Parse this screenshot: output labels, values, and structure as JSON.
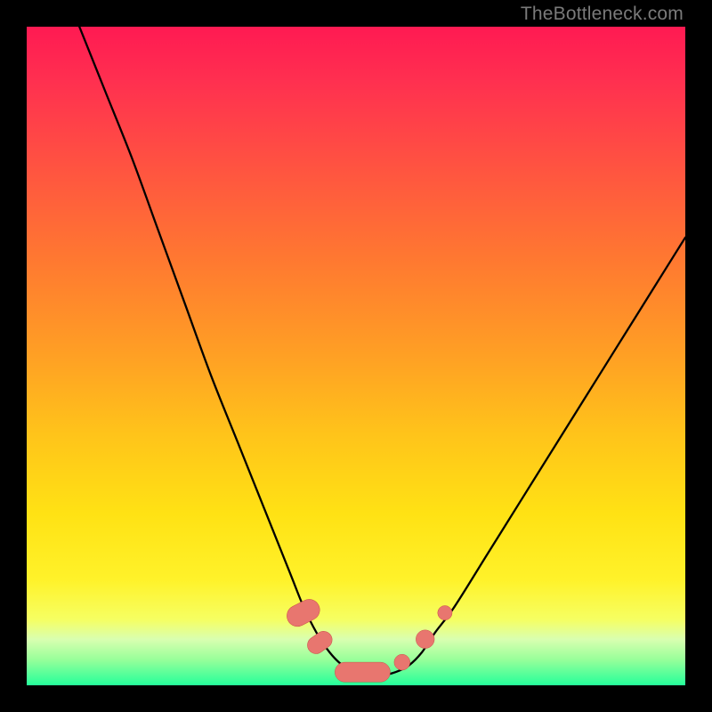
{
  "watermark": "TheBottleneck.com",
  "colors": {
    "frame": "#000000",
    "gradient_top": "#ff1a52",
    "gradient_bottom": "#25ff9a",
    "curve_stroke": "#000000",
    "marker_fill": "#e8766f",
    "marker_stroke": "#c94f46"
  },
  "chart_data": {
    "type": "line",
    "title": "",
    "xlabel": "",
    "ylabel": "",
    "xlim": [
      0,
      100
    ],
    "ylim": [
      0,
      100
    ],
    "grid": false,
    "legend": false,
    "note": "Both axes are unlabeled in the source; values below are estimated percentages of the plot extent (0 = left/bottom, 100 = right/top).",
    "series": [
      {
        "name": "curve",
        "x": [
          8,
          12,
          16,
          20,
          24,
          28,
          32,
          36,
          40,
          42,
          44,
          46,
          48,
          50,
          52,
          54,
          56,
          58,
          60,
          62,
          65,
          70,
          75,
          80,
          85,
          90,
          95,
          100
        ],
        "y": [
          100,
          90,
          80,
          69,
          58,
          47,
          37,
          27,
          17,
          12,
          8,
          5,
          3,
          2,
          1.5,
          1.5,
          2,
          3,
          5,
          8,
          12,
          20,
          28,
          36,
          44,
          52,
          60,
          68
        ]
      }
    ],
    "markers": [
      {
        "shape": "pill",
        "cx": 42.0,
        "cy": 11.0,
        "rx": 1.6,
        "ry": 2.6,
        "angle": 63
      },
      {
        "shape": "pill",
        "cx": 44.5,
        "cy": 6.5,
        "rx": 1.3,
        "ry": 2.0,
        "angle": 55
      },
      {
        "shape": "pill",
        "cx": 51.0,
        "cy": 2.0,
        "rx": 4.2,
        "ry": 1.5,
        "angle": 0
      },
      {
        "shape": "circle",
        "cx": 57.0,
        "cy": 3.5,
        "r": 1.2
      },
      {
        "shape": "circle",
        "cx": 60.5,
        "cy": 7.0,
        "r": 1.4
      },
      {
        "shape": "circle",
        "cx": 63.5,
        "cy": 11.0,
        "r": 1.1
      }
    ]
  }
}
